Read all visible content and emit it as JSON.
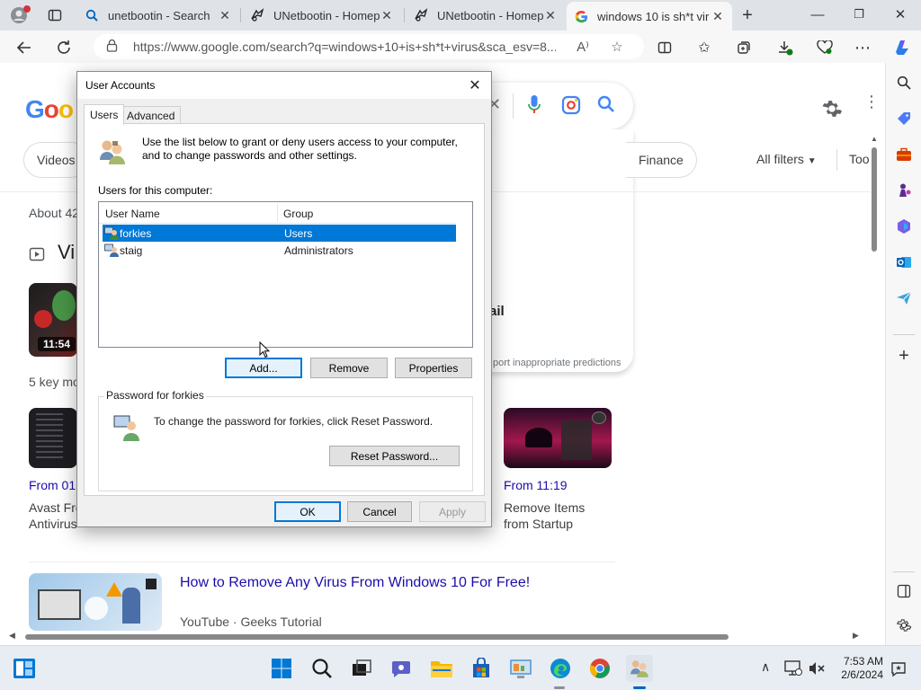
{
  "browser": {
    "tabs": [
      {
        "title": "unetbootin - Search",
        "icon": "search-icon"
      },
      {
        "title": "UNetbootin - Homepa",
        "icon": "unetbootin-icon"
      },
      {
        "title": "UNetbootin - Homepa",
        "icon": "unetbootin-icon"
      },
      {
        "title": "windows 10 is sh*t vir",
        "icon": "google-icon"
      }
    ],
    "url": "https://www.google.com/search?q=windows+10+is+sh*t+virus&sca_esv=8..."
  },
  "google": {
    "logo": "Goo",
    "chips": [
      "Videos",
      "Finance"
    ],
    "all_filters": "All filters",
    "tools": "Too",
    "about": "About 42",
    "videos_heading": "Vi",
    "duration": "11:54",
    "key_moments": "5 key mo",
    "suggestion_bold": "ail",
    "report": "port inappropriate predictions",
    "from_left": "From 01:",
    "from_right": "From 11:19",
    "left_caption_1": "Avast Fre",
    "left_caption_2": "Antivirus",
    "right_caption_1": "Remove Items",
    "right_caption_2": "from Startup",
    "result_title": "How to Remove Any Virus From Windows 10 For Free!",
    "result_source": "YouTube · Geeks Tutorial"
  },
  "dialog": {
    "title": "User Accounts",
    "tabs": [
      "Users",
      "Advanced"
    ],
    "intro": "Use the list below to grant or deny users access to your computer, and to change passwords and other settings.",
    "users_label": "Users for this computer:",
    "columns": [
      "User Name",
      "Group"
    ],
    "users": [
      {
        "name": "forkies",
        "group": "Users"
      },
      {
        "name": "staig",
        "group": "Administrators"
      }
    ],
    "buttons": {
      "add": "Add...",
      "remove": "Remove",
      "properties": "Properties"
    },
    "password_group": "Password for forkies",
    "password_text": "To change the password for forkies, click Reset Password.",
    "reset_button": "Reset Password...",
    "ok": "OK",
    "cancel": "Cancel",
    "apply": "Apply"
  },
  "taskbar": {
    "time": "7:53 AM",
    "date": "2/6/2024"
  },
  "colors": {
    "selection": "#0078d7",
    "google_link": "#1a0dab"
  }
}
